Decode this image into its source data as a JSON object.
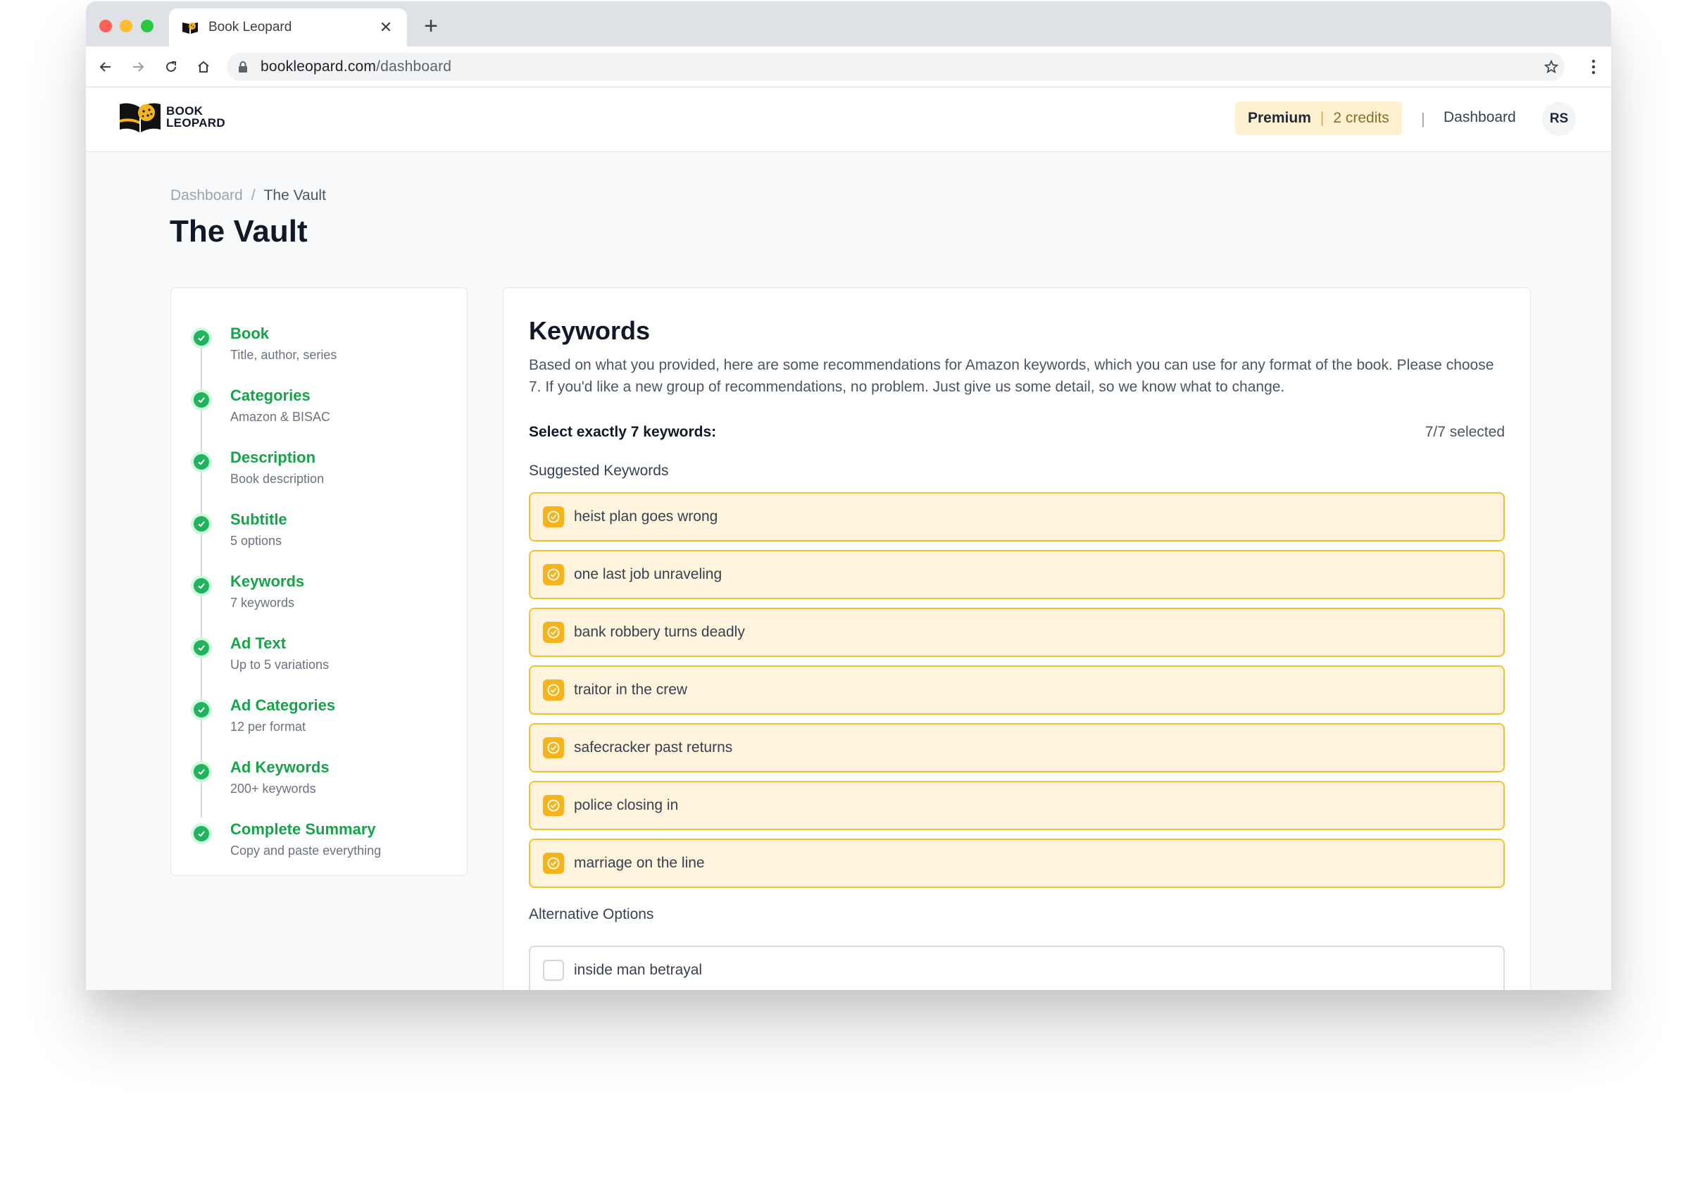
{
  "browser": {
    "tab_title": "Book Leopard",
    "url_host": "bookleopard.com",
    "url_path": "/dashboard"
  },
  "header": {
    "logo_line1": "BOOK",
    "logo_line2": "LEOPARD",
    "plan": "Premium",
    "plan_separator": "|",
    "credits": "2 credits",
    "separator": "|",
    "dashboard_link": "Dashboard",
    "avatar_initials": "RS"
  },
  "breadcrumb": {
    "root": "Dashboard",
    "separator": "/",
    "current": "The Vault"
  },
  "page_title": "The Vault",
  "steps": [
    {
      "title": "Book",
      "subtitle": "Title, author, series"
    },
    {
      "title": "Categories",
      "subtitle": "Amazon & BISAC"
    },
    {
      "title": "Description",
      "subtitle": "Book description"
    },
    {
      "title": "Subtitle",
      "subtitle": "5 options"
    },
    {
      "title": "Keywords",
      "subtitle": "7 keywords"
    },
    {
      "title": "Ad Text",
      "subtitle": "Up to 5 variations"
    },
    {
      "title": "Ad Categories",
      "subtitle": "12 per format"
    },
    {
      "title": "Ad Keywords",
      "subtitle": "200+ keywords"
    },
    {
      "title": "Complete Summary",
      "subtitle": "Copy and paste everything"
    }
  ],
  "keywords_panel": {
    "title": "Keywords",
    "description": "Based on what you provided, here are some recommendations for Amazon keywords, which you can use for any format of the book. Please choose 7. If you'd like a new group of recommendations, no problem. Just give us some detail, so we know what to change.",
    "select_label": "Select exactly 7 keywords:",
    "selected_count": "7/7 selected",
    "suggested_label": "Suggested Keywords",
    "suggested": [
      {
        "text": "heist plan goes wrong",
        "checked": true
      },
      {
        "text": "one last job unraveling",
        "checked": true
      },
      {
        "text": "bank robbery turns deadly",
        "checked": true
      },
      {
        "text": "traitor in the crew",
        "checked": true
      },
      {
        "text": "safecracker past returns",
        "checked": true
      },
      {
        "text": "police closing in",
        "checked": true
      },
      {
        "text": "marriage on the line",
        "checked": true
      }
    ],
    "alternative_label": "Alternative Options",
    "alternatives": [
      {
        "text": "inside man betrayal",
        "checked": false
      }
    ]
  },
  "colors": {
    "step_green": "#16a34a",
    "keyword_selected_bg": "#fef3dc",
    "keyword_selected_border": "#f3c02e",
    "checkbox_amber": "#f5b31c",
    "premium_bg": "#fdf1cf"
  }
}
